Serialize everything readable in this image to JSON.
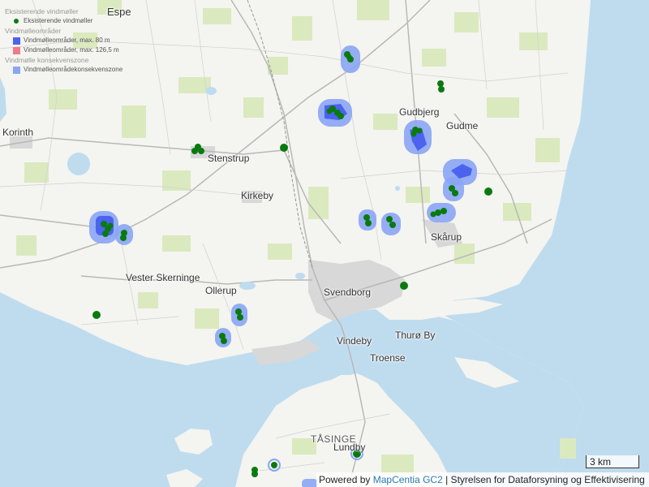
{
  "legend": {
    "existing_header": "Eksisterende vindmøller",
    "existing_item": "Eksisterende vindmøller",
    "areas_header": "Vindmølleområder",
    "areas_item_80": "Vindmølleområder, max. 80 m",
    "areas_item_126": "Vindmølleområder, max. 126,5 m",
    "zone_header": "Vindmølle konsekvenszone",
    "zone_item": "Vindmølleområdekonsekvenszone",
    "colors": {
      "turbine": "#0a7a10",
      "area80": "#4b63ee",
      "area126": "#f07a8a",
      "zone": "#8aa5f5"
    }
  },
  "places": {
    "espe": "Espe",
    "korinth": "Korinth",
    "stenstrup": "Stenstrup",
    "kirkeby": "Kirkeby",
    "gudbjerg": "Gudbjerg",
    "gudme": "Gudme",
    "skarup": "Skårup",
    "vester_skerninge": "Vester Skerninge",
    "ollerup": "Ollerup",
    "svendborg": "Svendborg",
    "vindeby": "Vindeby",
    "thuro_by": "Thurø By",
    "troense": "Troense",
    "tasinge": "TÅSINGE",
    "lundby": "Lundby"
  },
  "scale": {
    "label": "3 km"
  },
  "attribution": {
    "prefix": "Powered by",
    "link": "MapCentia GC2",
    "suffix": "| Styrelsen for Dataforsyning og Effektivisering"
  }
}
